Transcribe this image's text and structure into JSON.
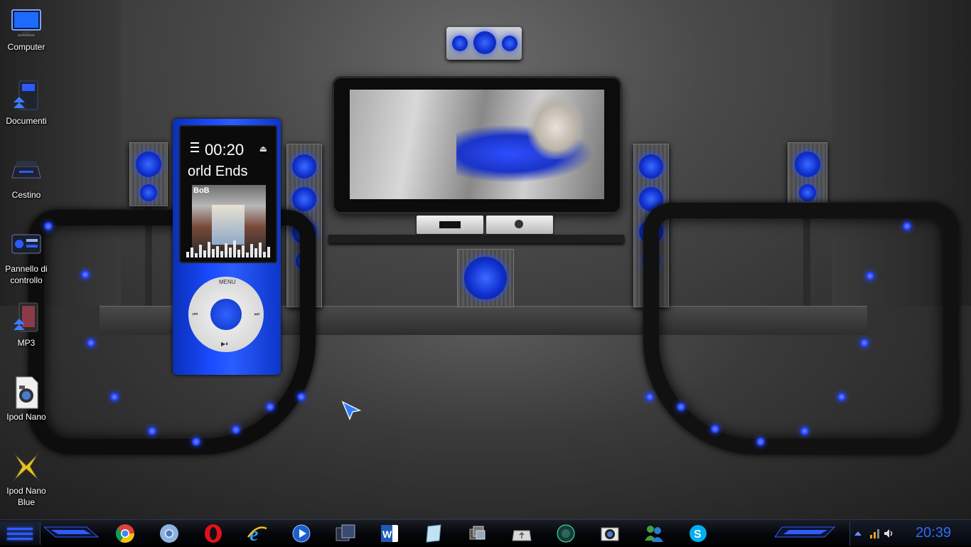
{
  "desktop": {
    "icons": [
      {
        "label": "Computer",
        "icon": "monitor-icon"
      },
      {
        "label": "Documenti",
        "icon": "documents-icon"
      },
      {
        "label": "Cestino",
        "icon": "recycle-bin-icon"
      },
      {
        "label": "Pannello di controllo",
        "icon": "control-panel-icon"
      },
      {
        "label": "MP3",
        "icon": "mp3-folder-icon"
      },
      {
        "label": "Ipod Nano",
        "icon": "image-file-icon"
      },
      {
        "label": "Ipod Nano Blue",
        "icon": "xfire-icon"
      }
    ]
  },
  "ipod_gadget": {
    "time": "00:20",
    "song": "orld Ends",
    "album_art_text": "BoB",
    "wheel_menu_label": "MENU",
    "wheel_prev_label": "⏮",
    "wheel_next_label": "⏭",
    "wheel_play_label": "▶⏸"
  },
  "taskbar": {
    "pinned": [
      {
        "icon": "chrome-icon"
      },
      {
        "icon": "chromium-icon"
      },
      {
        "icon": "opera-icon"
      },
      {
        "icon": "internet-explorer-icon"
      },
      {
        "icon": "media-player-icon"
      },
      {
        "icon": "file-manager-icon"
      },
      {
        "icon": "word-icon"
      },
      {
        "icon": "notes-icon"
      },
      {
        "icon": "gallery-icon"
      },
      {
        "icon": "usb-drive-icon"
      },
      {
        "icon": "gadget-icon"
      },
      {
        "icon": "camera-icon"
      },
      {
        "icon": "messenger-icon"
      },
      {
        "icon": "skype-icon"
      }
    ],
    "tray": {
      "clock": "20:39",
      "icons": [
        "network-icon",
        "volume-icon"
      ]
    }
  },
  "colors": {
    "accent": "#2f5bff",
    "clock": "#2f6bff",
    "ipod_body": "#1a4bff"
  }
}
